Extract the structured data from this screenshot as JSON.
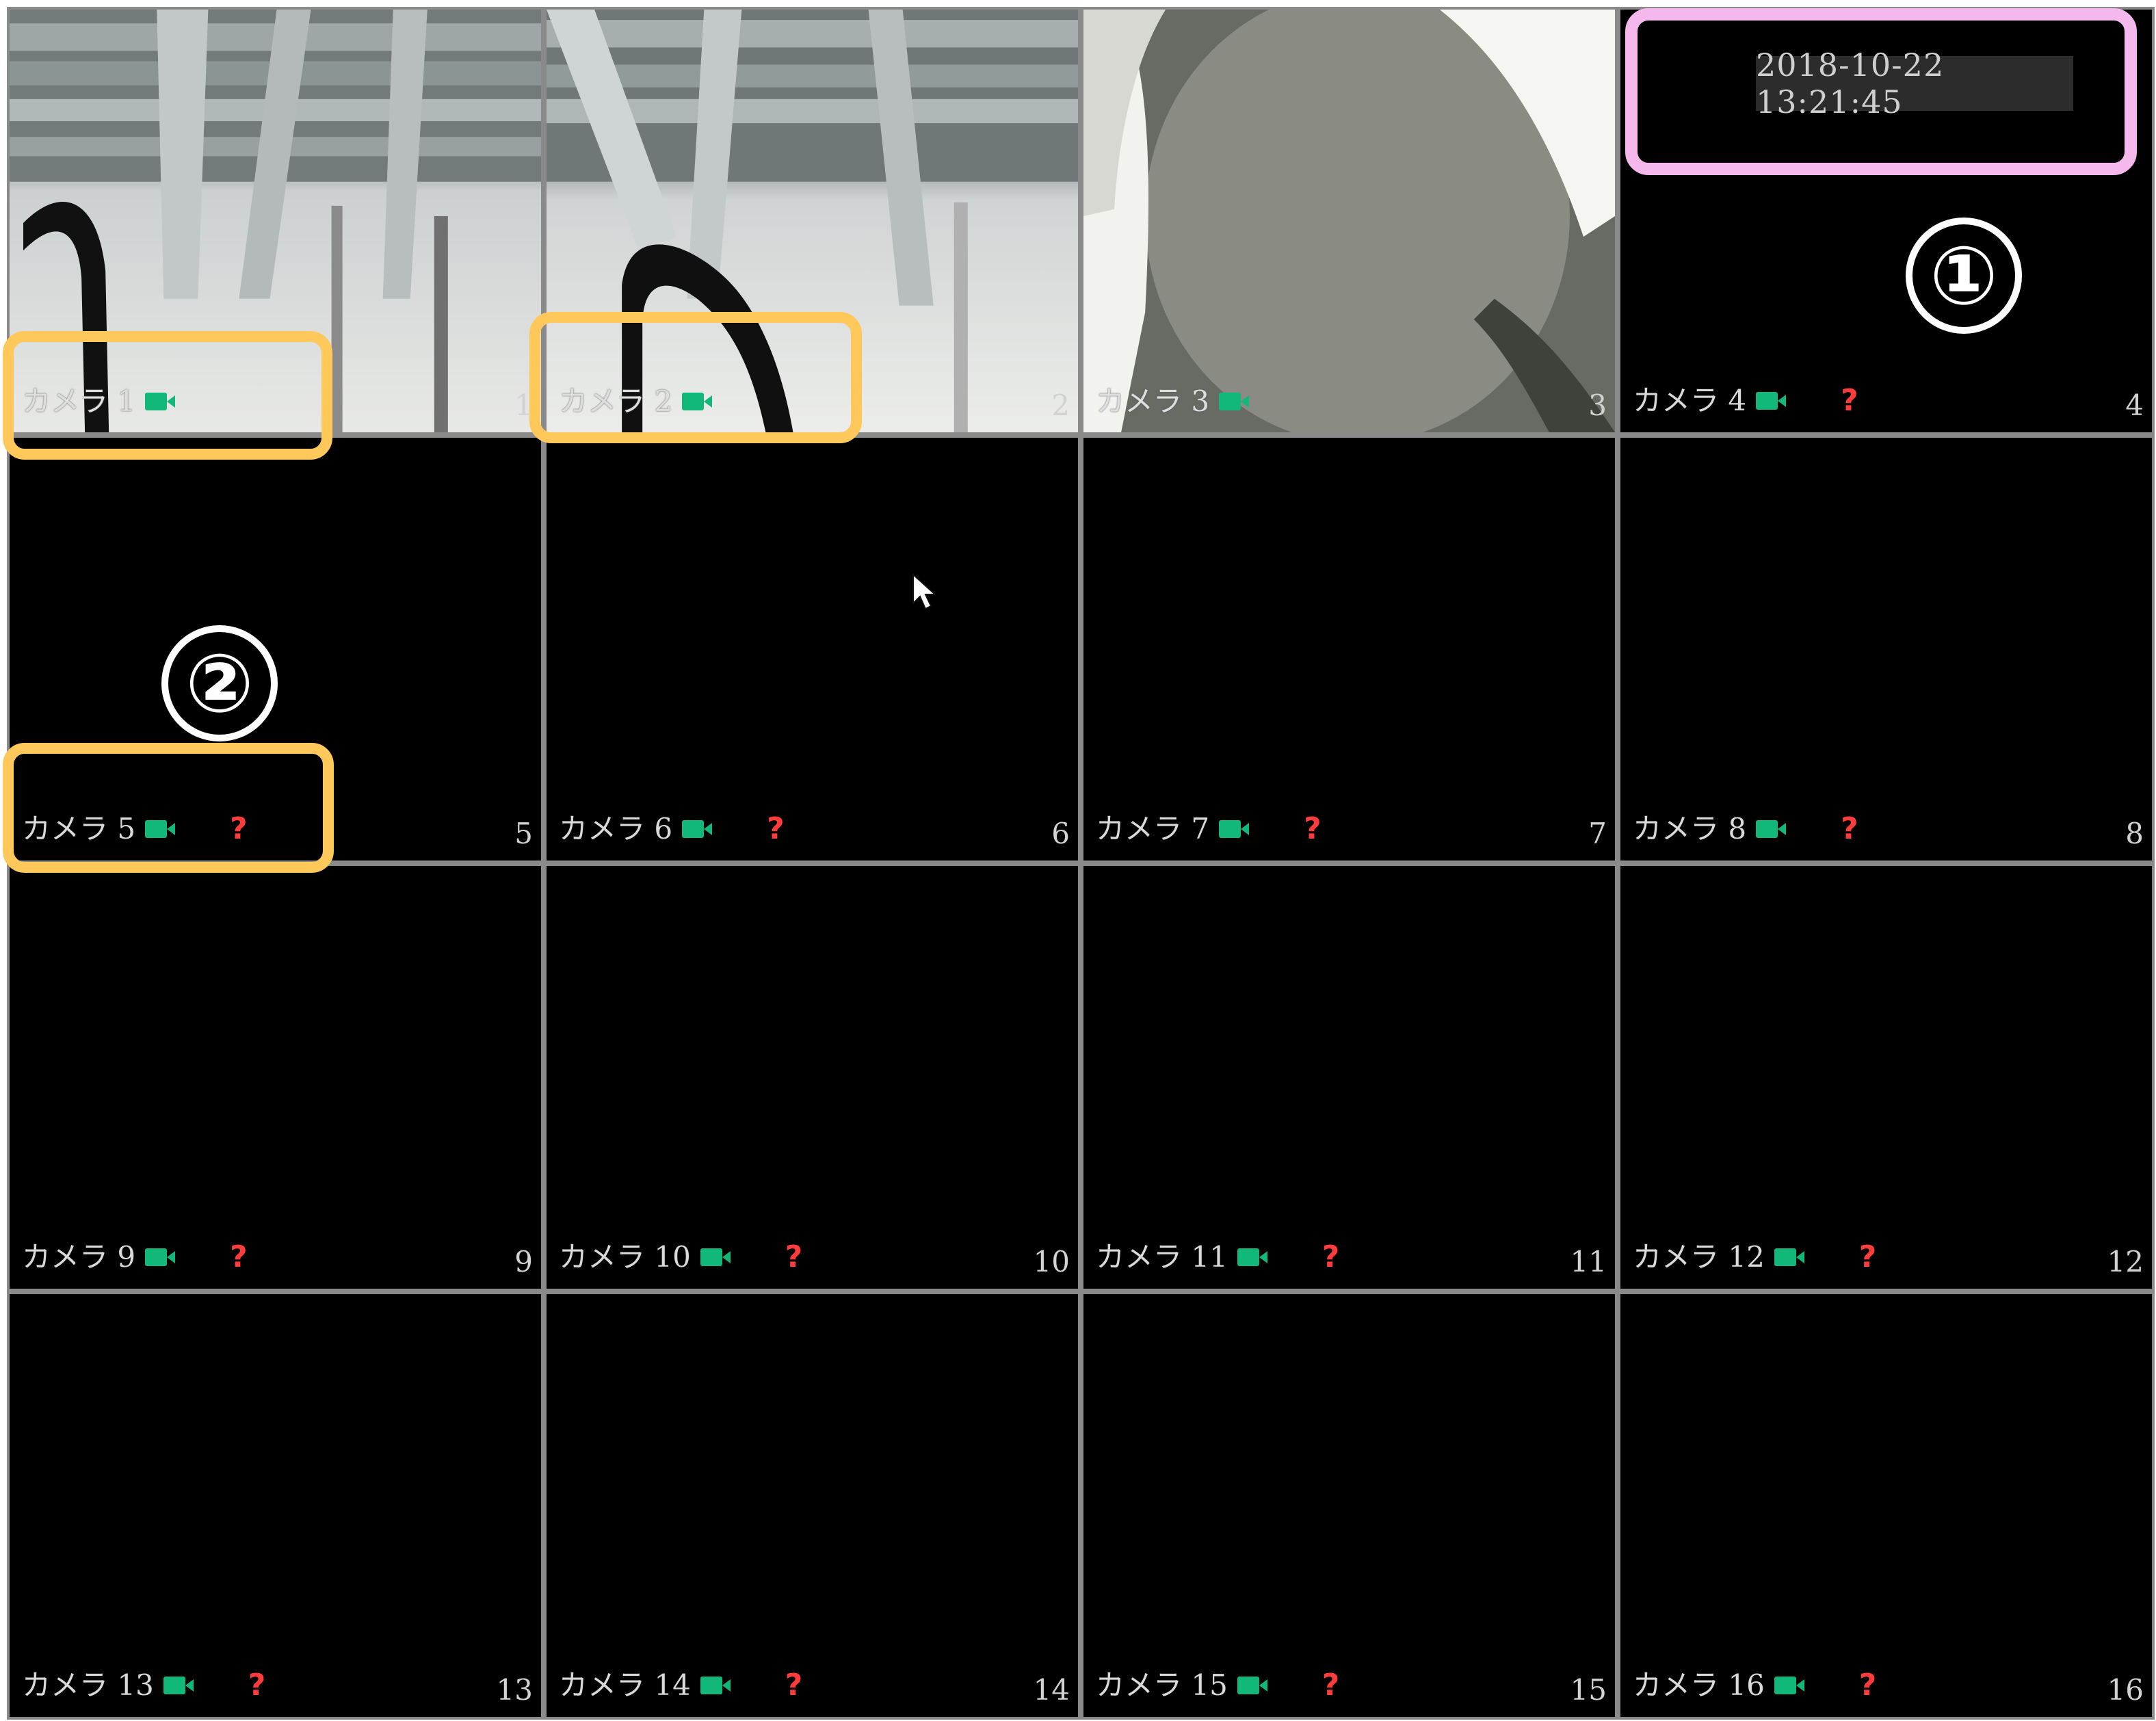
{
  "timestamp": "2018-10-22 13:21:45",
  "markers": {
    "first": "①",
    "second": "②"
  },
  "icons": {
    "video": "video-camera-icon",
    "unknown": "question-mark-icon",
    "cursor": "mouse-pointer-icon"
  },
  "colors": {
    "grid_border": "#8a8a8a",
    "video_icon": "#12b87a",
    "unknown_icon": "#ff3c3c",
    "timestamp_box": "#f5b8ec",
    "camera_highlight": "#ffc85a"
  },
  "cameras": [
    {
      "label": "カメラ 1",
      "number": "1",
      "has_unknown": false
    },
    {
      "label": "カメラ 2",
      "number": "2",
      "has_unknown": false
    },
    {
      "label": "カメラ 3",
      "number": "3",
      "has_unknown": false
    },
    {
      "label": "カメラ 4",
      "number": "4",
      "has_unknown": true
    },
    {
      "label": "カメラ 5",
      "number": "5",
      "has_unknown": true
    },
    {
      "label": "カメラ 6",
      "number": "6",
      "has_unknown": true
    },
    {
      "label": "カメラ 7",
      "number": "7",
      "has_unknown": true
    },
    {
      "label": "カメラ 8",
      "number": "8",
      "has_unknown": true
    },
    {
      "label": "カメラ 9",
      "number": "9",
      "has_unknown": true
    },
    {
      "label": "カメラ 10",
      "number": "10",
      "has_unknown": true
    },
    {
      "label": "カメラ 11",
      "number": "11",
      "has_unknown": true
    },
    {
      "label": "カメラ 12",
      "number": "12",
      "has_unknown": true
    },
    {
      "label": "カメラ 13",
      "number": "13",
      "has_unknown": true
    },
    {
      "label": "カメラ 14",
      "number": "14",
      "has_unknown": true
    },
    {
      "label": "カメラ 15",
      "number": "15",
      "has_unknown": true
    },
    {
      "label": "カメラ 16",
      "number": "16",
      "has_unknown": true
    }
  ],
  "unknown_symbol": "?"
}
